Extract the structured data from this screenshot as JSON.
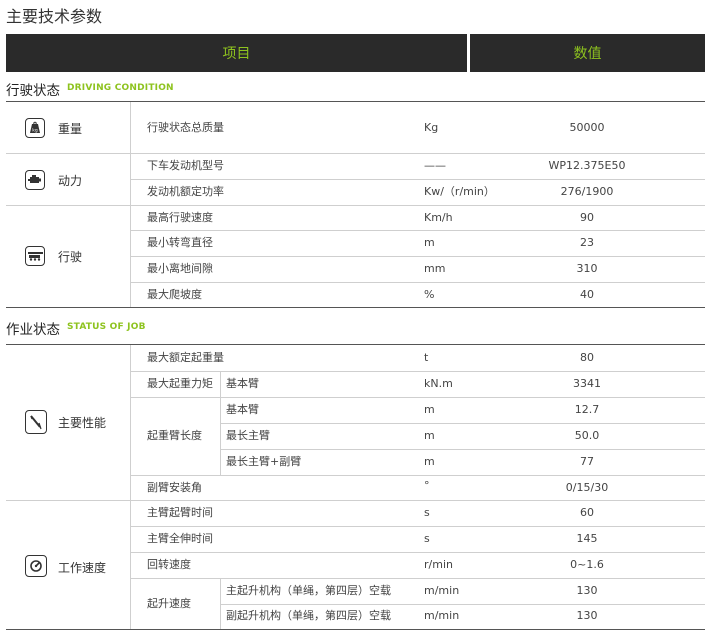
{
  "page_title": "主要技术参数",
  "header": {
    "col_item": "项目",
    "col_value": "数值"
  },
  "sections": [
    {
      "title": "行驶状态",
      "subtitle": "DRIVING CONDITION"
    },
    {
      "title": "作业状态",
      "subtitle": "STATUS OF JOB"
    }
  ],
  "categories": {
    "weight": "重量",
    "power": "动力",
    "driving": "行驶",
    "performance": "主要性能",
    "speed": "工作速度"
  },
  "icons": {
    "weight": "kg-weight-icon",
    "power": "engine-icon",
    "driving": "truck-icon",
    "performance": "crane-boom-icon",
    "speed": "speedometer-icon"
  },
  "groups": {
    "max_lift_moment": "最大起重力矩",
    "boom_length": "起重臂长度",
    "hoist_speed": "起升速度"
  },
  "rows": [
    {
      "param": "行驶状态总质量",
      "unit": "Kg",
      "value": "50000"
    },
    {
      "param": "下车发动机型号",
      "unit": "——",
      "value": "WP12.375E50"
    },
    {
      "param": "发动机额定功率",
      "unit": "Kw/（r/min）",
      "value": "276/1900"
    },
    {
      "param": "最高行驶速度",
      "unit": "Km/h",
      "value": "90"
    },
    {
      "param": "最小转弯直径",
      "unit": "m",
      "value": "23"
    },
    {
      "param": "最小离地间隙",
      "unit": "mm",
      "value": "310"
    },
    {
      "param": "最大爬坡度",
      "unit": "%",
      "value": "40"
    },
    {
      "param": "最大额定起重量",
      "unit": "t",
      "value": "80"
    },
    {
      "param": "基本臂",
      "unit": "kN.m",
      "value": "3341"
    },
    {
      "param": "基本臂",
      "unit": "m",
      "value": "12.7"
    },
    {
      "param": "最长主臂",
      "unit": "m",
      "value": "50.0"
    },
    {
      "param": "最长主臂+副臂",
      "unit": "m",
      "value": "77"
    },
    {
      "param": "副臂安装角",
      "unit": "°",
      "value": "0/15/30"
    },
    {
      "param": "主臂起臂时间",
      "unit": "s",
      "value": "60"
    },
    {
      "param": "主臂全伸时间",
      "unit": "s",
      "value": "145"
    },
    {
      "param": "回转速度",
      "unit": "r/min",
      "value": "0~1.6"
    },
    {
      "param": "主起升机构（单绳，第四层）空载",
      "unit": "m/min",
      "value": "130"
    },
    {
      "param": "副起升机构（单绳，第四层）空载",
      "unit": "m/min",
      "value": "130"
    }
  ]
}
